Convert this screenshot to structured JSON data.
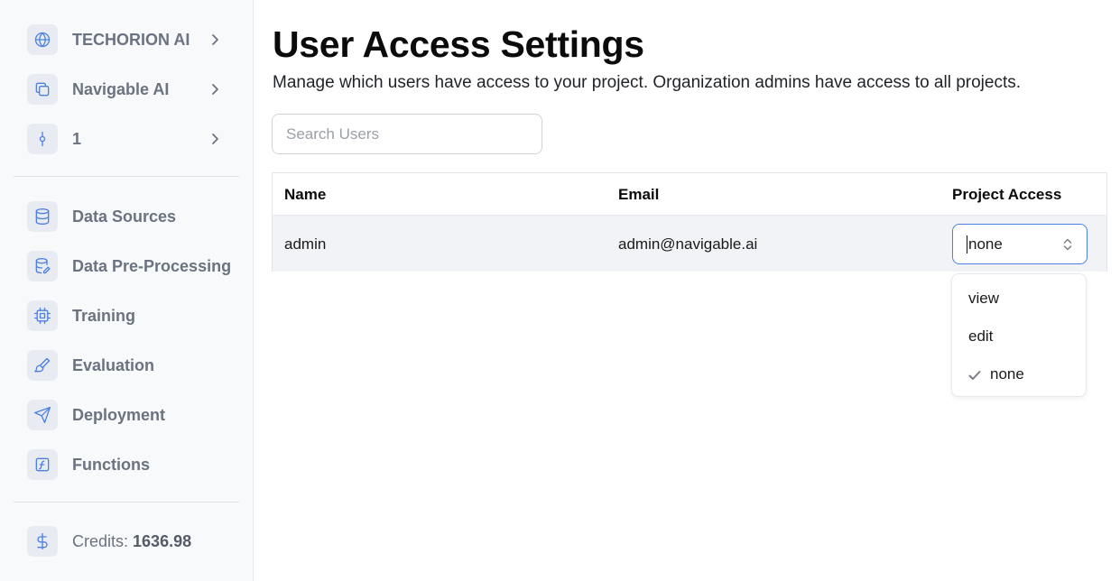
{
  "sidebar": {
    "org": {
      "label": "TECHORION AI",
      "icon": "globe-icon"
    },
    "project": {
      "label": "Navigable AI",
      "icon": "copy-icon"
    },
    "version": {
      "label": "1",
      "icon": "git-commit-icon"
    },
    "items": [
      {
        "label": "Data Sources",
        "icon": "database-icon"
      },
      {
        "label": "Data Pre-Processing",
        "icon": "database-edit-icon"
      },
      {
        "label": "Training",
        "icon": "cpu-icon"
      },
      {
        "label": "Evaluation",
        "icon": "brush-icon"
      },
      {
        "label": "Deployment",
        "icon": "send-icon"
      },
      {
        "label": "Functions",
        "icon": "function-icon"
      }
    ],
    "credits": {
      "label": "Credits:",
      "value": "1636.98",
      "icon": "dollar-icon"
    }
  },
  "main": {
    "title": "User Access Settings",
    "description": "Manage which users have access to your project. Organization admins have access to all projects.",
    "search": {
      "placeholder": "Search Users",
      "value": ""
    },
    "table": {
      "headers": [
        "Name",
        "Email",
        "Project Access"
      ],
      "rows": [
        {
          "name": "admin",
          "email": "admin@navigable.ai",
          "access": "none"
        }
      ]
    },
    "access_dropdown": {
      "options": [
        "view",
        "edit",
        "none"
      ],
      "selected": "none"
    }
  },
  "colors": {
    "accent": "#4d80e4",
    "sidebar_bg": "#f8f9fb",
    "row_bg": "#f2f3f6"
  }
}
